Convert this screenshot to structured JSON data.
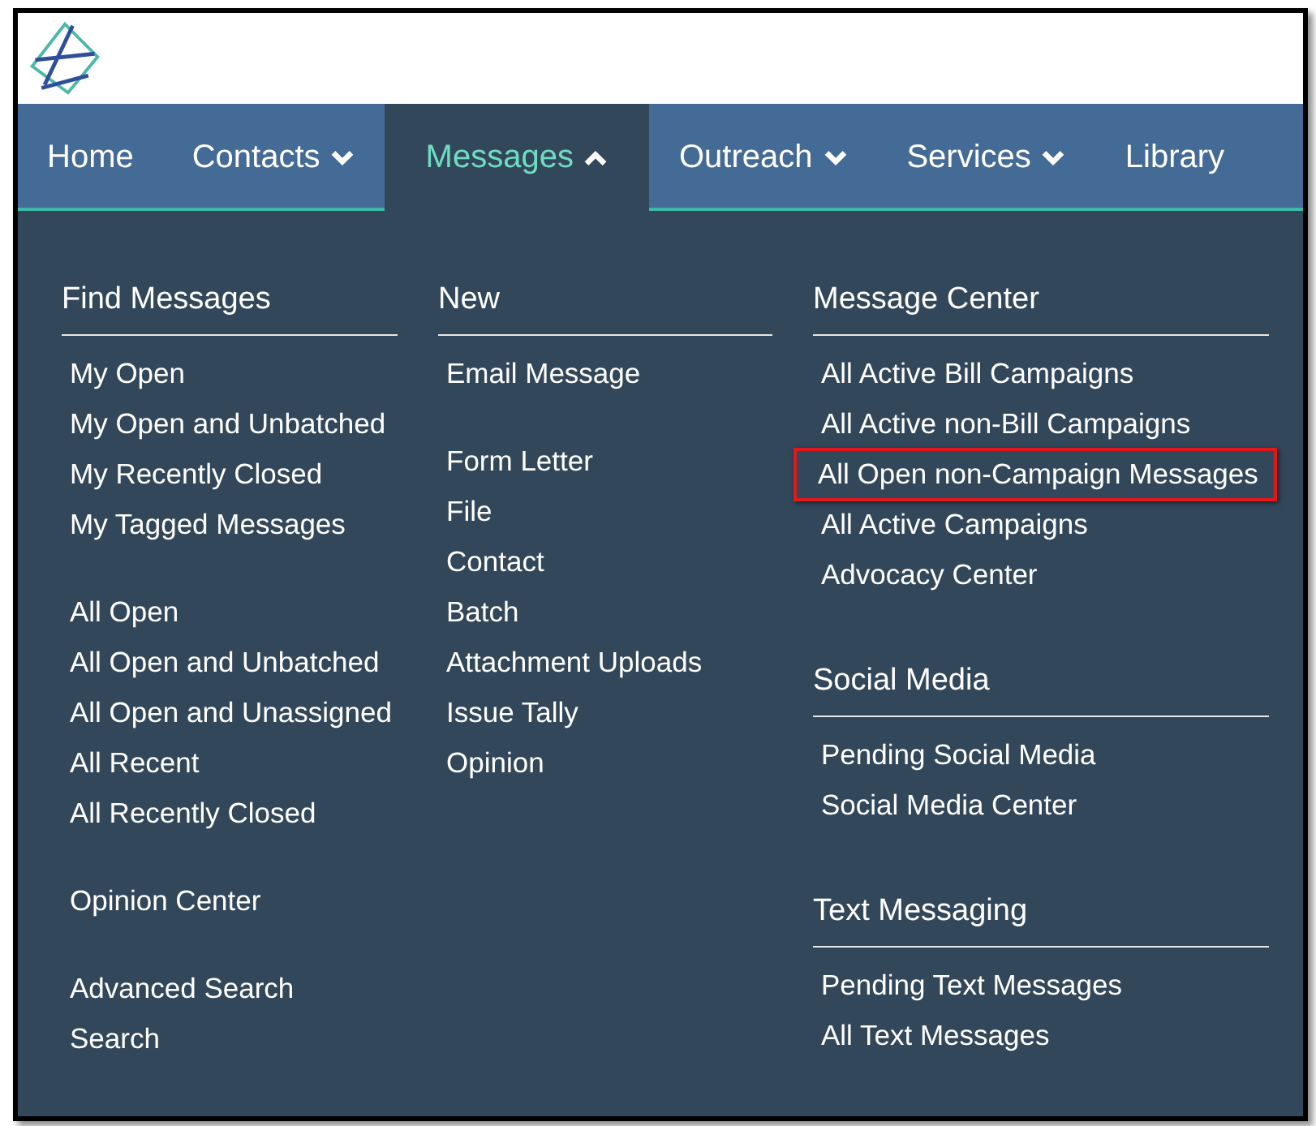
{
  "nav": [
    {
      "label": "Home",
      "kind": "link",
      "selected": false
    },
    {
      "label": "Contacts",
      "kind": "dropdown",
      "expanded": false,
      "selected": false
    },
    {
      "label": "Messages",
      "kind": "dropdown",
      "expanded": true,
      "selected": true
    },
    {
      "label": "Outreach",
      "kind": "dropdown",
      "expanded": false,
      "selected": false
    },
    {
      "label": "Services",
      "kind": "dropdown",
      "expanded": false,
      "selected": false
    },
    {
      "label": "Library",
      "kind": "link",
      "selected": false
    }
  ],
  "menu_columns": [
    {
      "sections": [
        {
          "heading": "Find Messages",
          "groups": [
            [
              {
                "label": "My Open",
                "highlighted": false
              },
              {
                "label": "My Open and Unbatched",
                "highlighted": false
              },
              {
                "label": "My Recently Closed",
                "highlighted": false
              },
              {
                "label": "My Tagged Messages",
                "highlighted": false
              }
            ],
            [
              {
                "label": "All Open",
                "highlighted": false
              },
              {
                "label": "All Open and Unbatched",
                "highlighted": false
              },
              {
                "label": "All Open and Unassigned",
                "highlighted": false
              },
              {
                "label": "All Recent",
                "highlighted": false
              },
              {
                "label": "All Recently Closed",
                "highlighted": false
              }
            ],
            [
              {
                "label": "Opinion Center",
                "highlighted": false
              }
            ],
            [
              {
                "label": "Advanced Search",
                "highlighted": false
              },
              {
                "label": "Search",
                "highlighted": false
              }
            ]
          ]
        }
      ]
    },
    {
      "sections": [
        {
          "heading": "New",
          "groups": [
            [
              {
                "label": "Email Message",
                "highlighted": false
              }
            ],
            [
              {
                "label": "Form Letter",
                "highlighted": false
              },
              {
                "label": "File",
                "highlighted": false
              },
              {
                "label": "Contact",
                "highlighted": false
              },
              {
                "label": "Batch",
                "highlighted": false
              },
              {
                "label": "Attachment Uploads",
                "highlighted": false
              },
              {
                "label": "Issue Tally",
                "highlighted": false
              },
              {
                "label": "Opinion",
                "highlighted": false
              }
            ]
          ]
        }
      ]
    },
    {
      "sections": [
        {
          "heading": "Message Center",
          "groups": [
            [
              {
                "label": "All Active Bill Campaigns",
                "highlighted": false
              },
              {
                "label": "All Active non-Bill Campaigns",
                "highlighted": false
              },
              {
                "label": "All Open non-Campaign Messages",
                "highlighted": true
              },
              {
                "label": "All Active Campaigns",
                "highlighted": false
              },
              {
                "label": "Advocacy Center",
                "highlighted": false
              }
            ]
          ]
        },
        {
          "heading": "Social Media",
          "groups": [
            [
              {
                "label": "Pending Social Media",
                "highlighted": false
              },
              {
                "label": "Social Media Center",
                "highlighted": false
              }
            ]
          ]
        },
        {
          "heading": "Text Messaging",
          "groups": [
            [
              {
                "label": "Pending Text Messages",
                "highlighted": false
              },
              {
                "label": "All Text Messages",
                "highlighted": false
              }
            ]
          ]
        }
      ]
    }
  ]
}
